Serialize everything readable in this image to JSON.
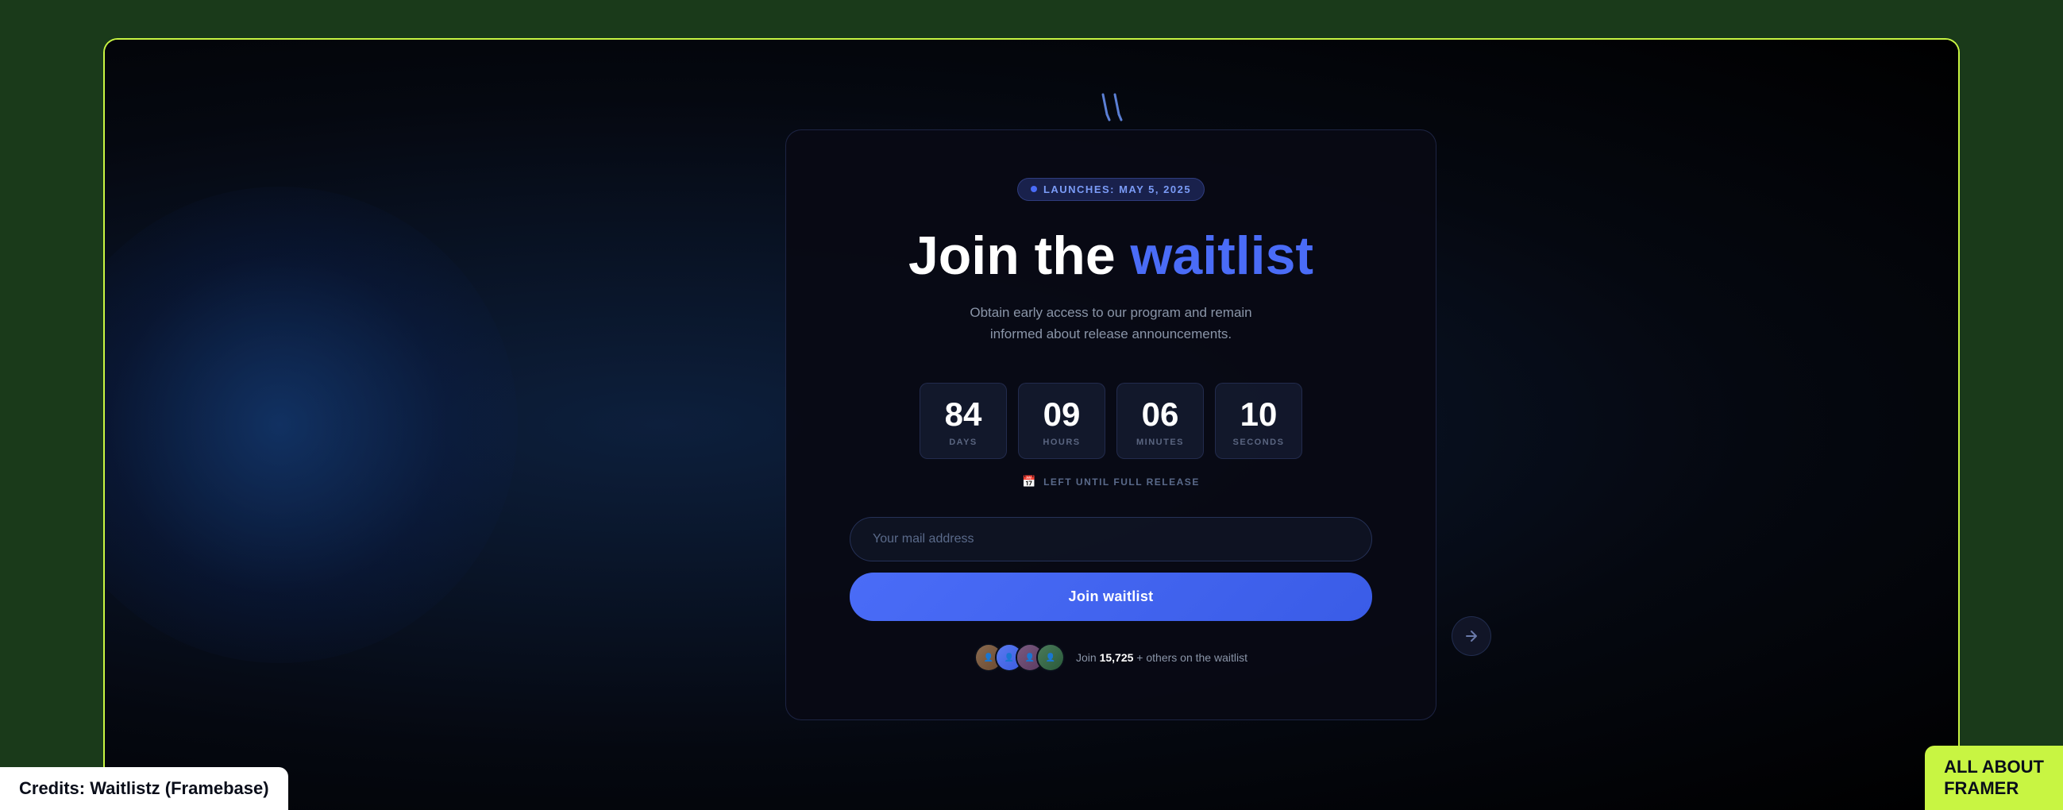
{
  "browser": {
    "bg_color": "#1a3a1a",
    "border_color": "#c8f542"
  },
  "badge": {
    "dot_color": "#4a6cf7",
    "text": "LAUNCHES: MAY 5, 2025"
  },
  "heading": {
    "part1": "Join the ",
    "highlight": "waitlist"
  },
  "subtitle": "Obtain early access to our program and remain informed about release announcements.",
  "countdown": {
    "days": {
      "value": "84",
      "label": "DAYS"
    },
    "hours": {
      "value": "09",
      "label": "HOURS"
    },
    "minutes": {
      "value": "06",
      "label": "MINUTES"
    },
    "seconds": {
      "value": "10",
      "label": "SECONDS"
    },
    "footer": "LEFT UNTIL FULL RELEASE"
  },
  "email_input": {
    "placeholder": "Your mail address"
  },
  "join_button": {
    "label": "Join waitlist"
  },
  "social_proof": {
    "count": "15,725",
    "suffix": " + others on the waitlist",
    "join_prefix": "Join "
  },
  "credits": {
    "label": "Credits: Waitlistz (Framebase)"
  },
  "framer_badge": {
    "line1": "ALL ABOUT",
    "line2": "FRAMER"
  }
}
